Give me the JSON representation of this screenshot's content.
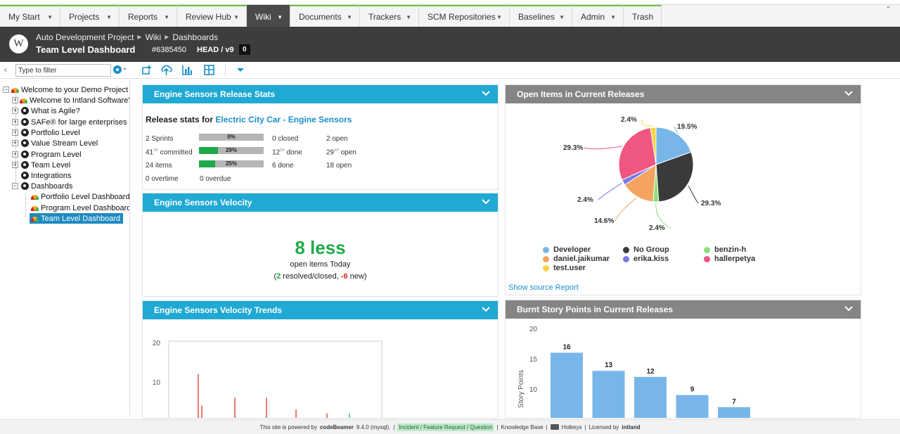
{
  "nav": {
    "tabs": [
      {
        "label": "My Start"
      },
      {
        "label": "Projects"
      },
      {
        "label": "Reports"
      },
      {
        "label": "Review Hub"
      },
      {
        "label": "Wiki"
      },
      {
        "label": "Documents"
      },
      {
        "label": "Trackers"
      },
      {
        "label": "SCM Repositories"
      },
      {
        "label": "Baselines"
      },
      {
        "label": "Admin"
      },
      {
        "label": "Trash"
      }
    ],
    "active": "Wiki"
  },
  "header": {
    "logo": "W",
    "breadcrumb": [
      "Auto Development Project",
      "Wiki",
      "Dashboards"
    ],
    "title": "Team Level Dashboard",
    "id": "#6385450",
    "version": "HEAD / v9",
    "badge": "0"
  },
  "toolbar": {
    "filter_placeholder": "Type to filter",
    "icons": [
      "add-page-icon",
      "upload-icon",
      "chart-icon",
      "layout-icon",
      "more-dropdown-icon"
    ]
  },
  "tree": {
    "nodes": [
      {
        "label": "Welcome to your Demo Project",
        "icon": "dashboard-icon"
      },
      {
        "label": "Welcome to Intland Software's",
        "icon": "dashboard-icon"
      },
      {
        "label": "What is Agile?",
        "icon": "page-icon"
      },
      {
        "label": "SAFe® for large enterprises",
        "icon": "page-icon"
      },
      {
        "label": "Portfolio Level",
        "icon": "page-icon"
      },
      {
        "label": "Value Stream Level",
        "icon": "page-icon"
      },
      {
        "label": "Program Level",
        "icon": "page-icon"
      },
      {
        "label": "Team Level",
        "icon": "page-icon"
      },
      {
        "label": "Integrations",
        "icon": "page-icon"
      },
      {
        "label": "Dashboards",
        "icon": "page-icon"
      },
      {
        "label": "Portfolio Level Dashboard",
        "icon": "dashboard-icon"
      },
      {
        "label": "Program Level Dashboard",
        "icon": "dashboard-icon"
      },
      {
        "label": "Team Level Dashboard",
        "icon": "dashboard-icon"
      }
    ],
    "selected": "Team Level Dashboard"
  },
  "release_stats": {
    "header": "Engine Sensors Release Stats",
    "title_prefix": "Release stats for",
    "release_link": "Electric City Car - Engine Sensors",
    "rows": [
      {
        "label": "2 Sprints",
        "progress": 0,
        "pct_label": "0%",
        "c1": "0 closed",
        "c2": "2 open"
      },
      {
        "label": "41",
        "unit": "SP",
        "suffix": "committed",
        "progress": 29,
        "pct_label": "29%",
        "c1": "12",
        "c1_unit": "SP",
        "c1_suffix": "done",
        "c2": "29",
        "c2_unit": "SP",
        "c2_suffix": "open"
      },
      {
        "label": "24 items",
        "progress": 25,
        "pct_label": "25%",
        "c1": "6 done",
        "c2": "18 open"
      }
    ],
    "overtime": "0 overtime",
    "overdue": "0 overdue"
  },
  "velocity": {
    "header": "Engine Sensors Velocity",
    "big": "8 less",
    "sub": "open items Today",
    "resolved": "2",
    "resolved_text": "resolved/closed,",
    "new": "-6",
    "new_text": "new)"
  },
  "velocity_trends": {
    "header": "Engine Sensors Velocity Trends",
    "y_ticks": [
      "20",
      "10"
    ]
  },
  "open_items": {
    "header": "Open Items in Current Releases",
    "link": "Show source Report",
    "legend": [
      {
        "name": "Developer",
        "color": "#78b6ea"
      },
      {
        "name": "No Group",
        "color": "#3a3a3a"
      },
      {
        "name": "benzin-h",
        "color": "#8ee07b"
      },
      {
        "name": "daniel.jaikumar",
        "color": "#f4a460"
      },
      {
        "name": "erika.kiss",
        "color": "#7a78e6"
      },
      {
        "name": "hallerpetya",
        "color": "#ef5680"
      },
      {
        "name": "test.user",
        "color": "#f5d547"
      }
    ]
  },
  "burnt": {
    "header": "Burnt Story Points in Current Releases",
    "ylabel": "Story Points"
  },
  "chart_data": [
    {
      "type": "pie",
      "title": "Open Items in Current Releases",
      "slices": [
        {
          "name": "Developer",
          "value": 19.5,
          "label": "19.5%"
        },
        {
          "name": "No Group",
          "value": 29.3,
          "label": "29.3%"
        },
        {
          "name": "benzin-h",
          "value": 2.4,
          "label": "2.4%"
        },
        {
          "name": "daniel.jaikumar",
          "value": 14.6,
          "label": "14.6%"
        },
        {
          "name": "erika.kiss",
          "value": 2.4,
          "label": "2.4%"
        },
        {
          "name": "hallerpetya",
          "value": 29.3,
          "label": "29.3%"
        },
        {
          "name": "test.user",
          "value": 2.4,
          "label": "2.4%"
        }
      ],
      "legend": "bottom"
    },
    {
      "type": "bar",
      "title": "Burnt Story Points in Current Releases",
      "ylabel": "Story Points",
      "y_ticks": [
        10,
        15,
        20
      ],
      "values": [
        16,
        13,
        12,
        9,
        7
      ],
      "color": "#78b6ea"
    },
    {
      "type": "bar",
      "title": "Engine Sensors Velocity Trends",
      "y_ticks": [
        10,
        20
      ],
      "series": [
        {
          "color": "#d9241c",
          "values": [
            12,
            4,
            6,
            6,
            3,
            2
          ]
        },
        {
          "color": "#1faa4a",
          "values": [
            2
          ]
        }
      ]
    }
  ],
  "footer": {
    "text1": "This site is powered by",
    "brand": "codeBeamer",
    "version": "9.4.0 (mysql).",
    "link": "Incident / Feature Request / Question",
    "kb": "Knowledge Base",
    "hotkeys": "Hotkeys",
    "licensed": "Licensed by",
    "company": "intland"
  }
}
